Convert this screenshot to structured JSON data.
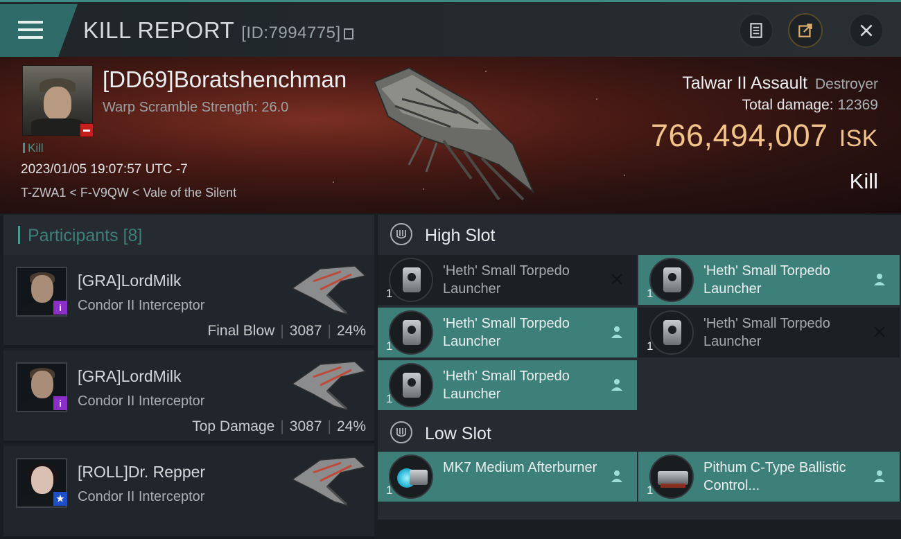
{
  "header": {
    "title": "KILL REPORT",
    "report_id": "[ID:7994775]"
  },
  "victim": {
    "name": "[DD69]Boratshenchman",
    "subtitle": "Warp Scramble Strength: 26.0",
    "tag": "Kill",
    "datetime": "2023/01/05 19:07:57 UTC -7",
    "location": "T-ZWA1 < F-V9QW < Vale of the Silent",
    "ship_name": "Talwar II Assault",
    "ship_class": "Destroyer",
    "damage_label": "Total damage:",
    "damage_value": "12369",
    "isk_value": "766,494,007",
    "isk_unit": "ISK",
    "result": "Kill"
  },
  "participants": {
    "title": "Participants [8]",
    "rows": [
      {
        "name": "[GRA]LordMilk",
        "ship": "Condor II Interceptor",
        "role": "Final Blow",
        "damage": "3087",
        "percent": "24%",
        "badge": "i",
        "badge_color": "#8a2fc8"
      },
      {
        "name": "[GRA]LordMilk",
        "ship": "Condor II Interceptor",
        "role": "Top Damage",
        "damage": "3087",
        "percent": "24%",
        "badge": "i",
        "badge_color": "#8a2fc8"
      },
      {
        "name": "[ROLL]Dr. Repper",
        "ship": "Condor II Interceptor",
        "role": "",
        "damage": "",
        "percent": "",
        "badge": "★",
        "badge_color": "#1f4fc8"
      }
    ]
  },
  "high_slot": {
    "title": "High Slot",
    "modules": [
      {
        "qty": "1",
        "name": "'Heth' Small Torpedo Launcher",
        "state": "destroyed"
      },
      {
        "qty": "1",
        "name": "'Heth' Small Torpedo Launcher",
        "state": "dropped"
      },
      {
        "qty": "1",
        "name": "'Heth' Small Torpedo Launcher",
        "state": "dropped"
      },
      {
        "qty": "1",
        "name": "'Heth' Small Torpedo Launcher",
        "state": "destroyed"
      },
      {
        "qty": "1",
        "name": "'Heth' Small Torpedo Launcher",
        "state": "dropped"
      }
    ]
  },
  "low_slot": {
    "title": "Low Slot",
    "modules": [
      {
        "qty": "1",
        "name": "MK7 Medium Afterburner",
        "state": "dropped"
      },
      {
        "qty": "1",
        "name": "Pithum C-Type Ballistic Control...",
        "state": "dropped"
      }
    ]
  },
  "colors": {
    "accent": "#3d7f79",
    "isk": "#f2c48a",
    "victim_badge": "#c81e1e"
  }
}
